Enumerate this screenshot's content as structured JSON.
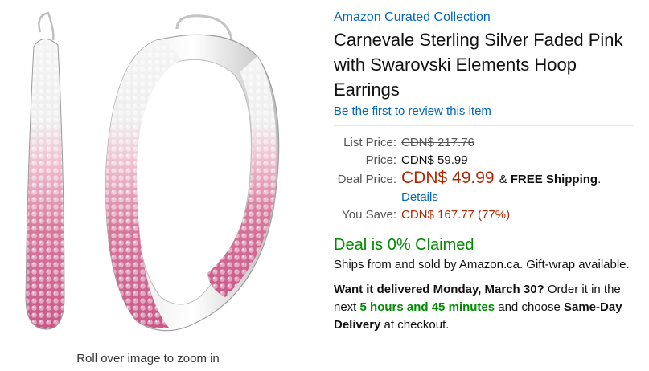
{
  "image": {
    "zoom_hint": "Roll over image to zoom in",
    "colors": {
      "crystal_pink": "#d77a9c",
      "crystal_white": "#f4f4f4",
      "silver": "#c9c9c9"
    }
  },
  "product": {
    "brand": "Amazon Curated Collection",
    "title": "Carnevale Sterling Silver Faded Pink with Swarovski Elements Hoop Earrings",
    "review_link": "Be the first to review this item"
  },
  "pricing": {
    "list_label": "List Price:",
    "list_value": "CDN$ 217.76",
    "price_label": "Price:",
    "price_value": "CDN$ 59.99",
    "deal_label": "Deal Price:",
    "deal_value": "CDN$ 49.99",
    "shipping_prefix": "&",
    "shipping_bold": "FREE Shipping",
    "shipping_suffix": ".",
    "details_link": "Details",
    "save_label": "You Save:",
    "save_value": "CDN$ 167.77 (77%)"
  },
  "deal": {
    "claimed": "Deal is 0% Claimed"
  },
  "fulfillment": {
    "ships_text": "Ships from and sold by Amazon.ca. Gift-wrap available.",
    "want_bold": "Want it delivered Monday, March 30?",
    "order_text": "Order it in the next",
    "countdown": "5 hours and 45 minutes",
    "choose_text": "and choose",
    "sameday_bold": "Same-Day Delivery",
    "checkout_text": "at checkout."
  },
  "colors": {
    "link": "#0066c0",
    "price_red": "#b12704",
    "deal_green": "#008a00"
  }
}
